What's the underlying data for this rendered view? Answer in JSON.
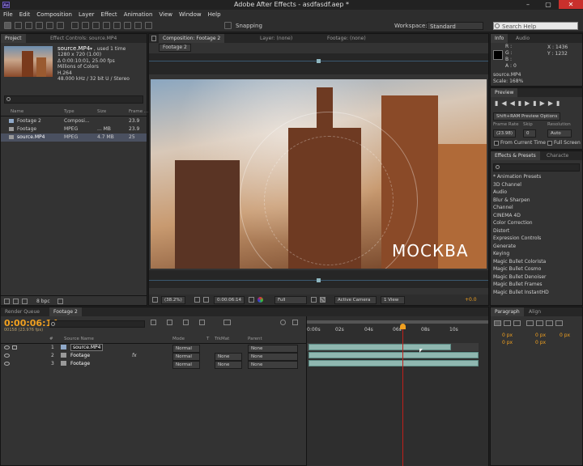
{
  "window": {
    "app_icon": "Ae",
    "title": "Adobe After Effects - asdfasdf.aep *",
    "controls": [
      "–",
      "▢",
      "✕"
    ]
  },
  "menu": [
    "File",
    "Edit",
    "Composition",
    "Layer",
    "Effect",
    "Animation",
    "View",
    "Window",
    "Help"
  ],
  "toolbar": {
    "snapping_label": "Snapping",
    "workspace_label": "Workspace:",
    "workspace_value": "Standard",
    "search_placeholder": "Search Help"
  },
  "project": {
    "tabs": [
      "Project",
      "Effect Controls: source.MP4"
    ],
    "item_name": "source.MP4",
    "item_used": "▾ , used 1 time",
    "info_lines": [
      "1280 x 720 (1.00)",
      "Δ 0:00:10:01, 25.00 fps",
      "Millions of Colors",
      "H.264",
      "48.000 kHz / 32 bit U / Stereo"
    ],
    "columns": [
      "Name",
      "Type",
      "Size",
      "Frame ..."
    ],
    "rows": [
      {
        "name": "Footage 2",
        "type": "Composi...",
        "size": "",
        "frame": "23.9"
      },
      {
        "name": "Footage",
        "type": "MPEG",
        "size": "... MB",
        "frame": "23.9"
      },
      {
        "name": "source.MP4",
        "type": "MPEG",
        "size": "4.7 MB",
        "frame": "25"
      }
    ],
    "bpc": "8 bpc"
  },
  "composition": {
    "tabs": [
      "Composition: Footage 2",
      "Layer: (none)",
      "Footage: (none)"
    ],
    "breadcrumb": "Footage 2",
    "overlay_text": "МОСКВА",
    "zoom": "(38.2%)",
    "timecode": "0:00:06:14",
    "resolution": "Full",
    "camera": "Active Camera",
    "views": "1 View",
    "exposure": "+0.0"
  },
  "info": {
    "tabs": [
      "Info",
      "Audio"
    ],
    "rgb_labels": [
      "R :",
      "G :",
      "B :",
      "A : 0"
    ],
    "x": "X : 1436",
    "y": "Y : 1232",
    "source": "source.MP4",
    "scale": "Scale: 168%"
  },
  "preview": {
    "tab": "Preview",
    "ram_option": "Shift+RAM Preview Options",
    "labels": [
      "Frame Rate",
      "Skip",
      "Resolution"
    ],
    "values": [
      "(23.98)",
      "0",
      "Auto"
    ],
    "from_current": "From Current Time",
    "full_screen": "Full Screen"
  },
  "effects": {
    "tabs": [
      "Effects & Presets",
      "Characte"
    ],
    "items": [
      "* Animation Presets",
      "3D Channel",
      "Audio",
      "Blur & Sharpen",
      "Channel",
      "CINEMA 4D",
      "Color Correction",
      "Distort",
      "Expression Controls",
      "Generate",
      "Keying",
      "Magic Bullet Colorista",
      "Magic Bullet Cosmo",
      "Magic Bullet Denoiser",
      "Magic Bullet Frames",
      "Magic Bullet InstantHD"
    ]
  },
  "timeline": {
    "tabs": [
      "Render Queue",
      "Footage 2"
    ],
    "timecode": "0:00:06:14",
    "frame_info": "00158 (23.976 fps)",
    "columns": [
      "#",
      "Source Name",
      "Mode",
      "T",
      "TrkMat",
      "Parent"
    ],
    "layers": [
      {
        "num": "1",
        "name": "source.MP4",
        "mode": "Normal",
        "trkmat": "",
        "parent": "None"
      },
      {
        "num": "2",
        "name": "Footage",
        "mode": "Normal",
        "trkmat": "None",
        "parent": "None"
      },
      {
        "num": "3",
        "name": "Footage",
        "mode": "Normal",
        "trkmat": "None",
        "parent": "None"
      }
    ],
    "ruler": [
      "0:00s",
      "02s",
      "04s",
      "06s",
      "08s",
      "10s"
    ],
    "current_time_fraction": 0.555
  },
  "paragraph": {
    "tabs": [
      "Paragraph",
      "Align"
    ],
    "fields": [
      "0 px",
      "0 px",
      "0 px",
      "0 px",
      "0 px"
    ]
  },
  "colors": {
    "accent": "#f0a020",
    "playhead": "#c0201a",
    "layer_bar": "#8fb7b0"
  }
}
